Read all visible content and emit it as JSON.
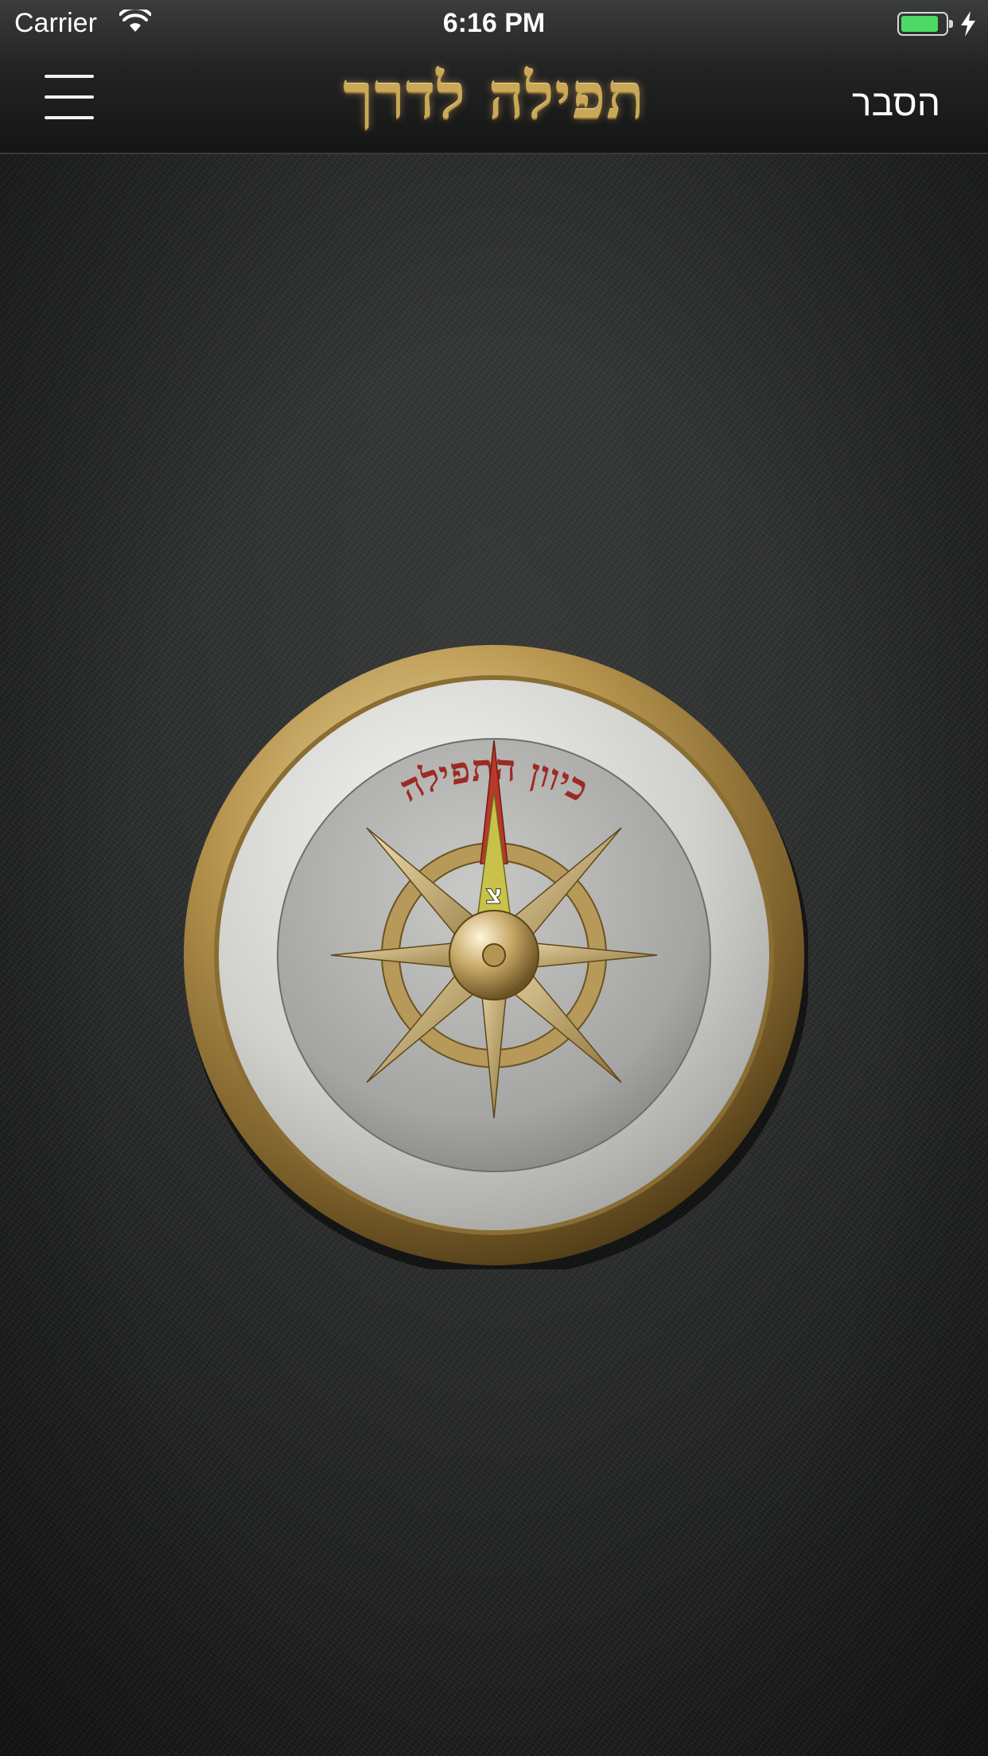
{
  "status_bar": {
    "carrier": "Carrier",
    "time": "6:16 PM",
    "battery_color": "#4cd964",
    "icons": [
      "wifi-icon",
      "battery-icon",
      "charging-bolt-icon"
    ]
  },
  "nav": {
    "title": "תפילה לדרך",
    "explain_label": "הסבר",
    "menu_icon": "hamburger-menu-icon",
    "title_color": "#c9a957"
  },
  "compass": {
    "ring_label": "כיוון התפילה",
    "needle_letter": "צ",
    "ring_color": "#b08f4f",
    "needle_colors": [
      "#c0392b",
      "#c8c24a"
    ]
  },
  "background": {
    "texture": "dark-leather",
    "color": "#262828"
  }
}
